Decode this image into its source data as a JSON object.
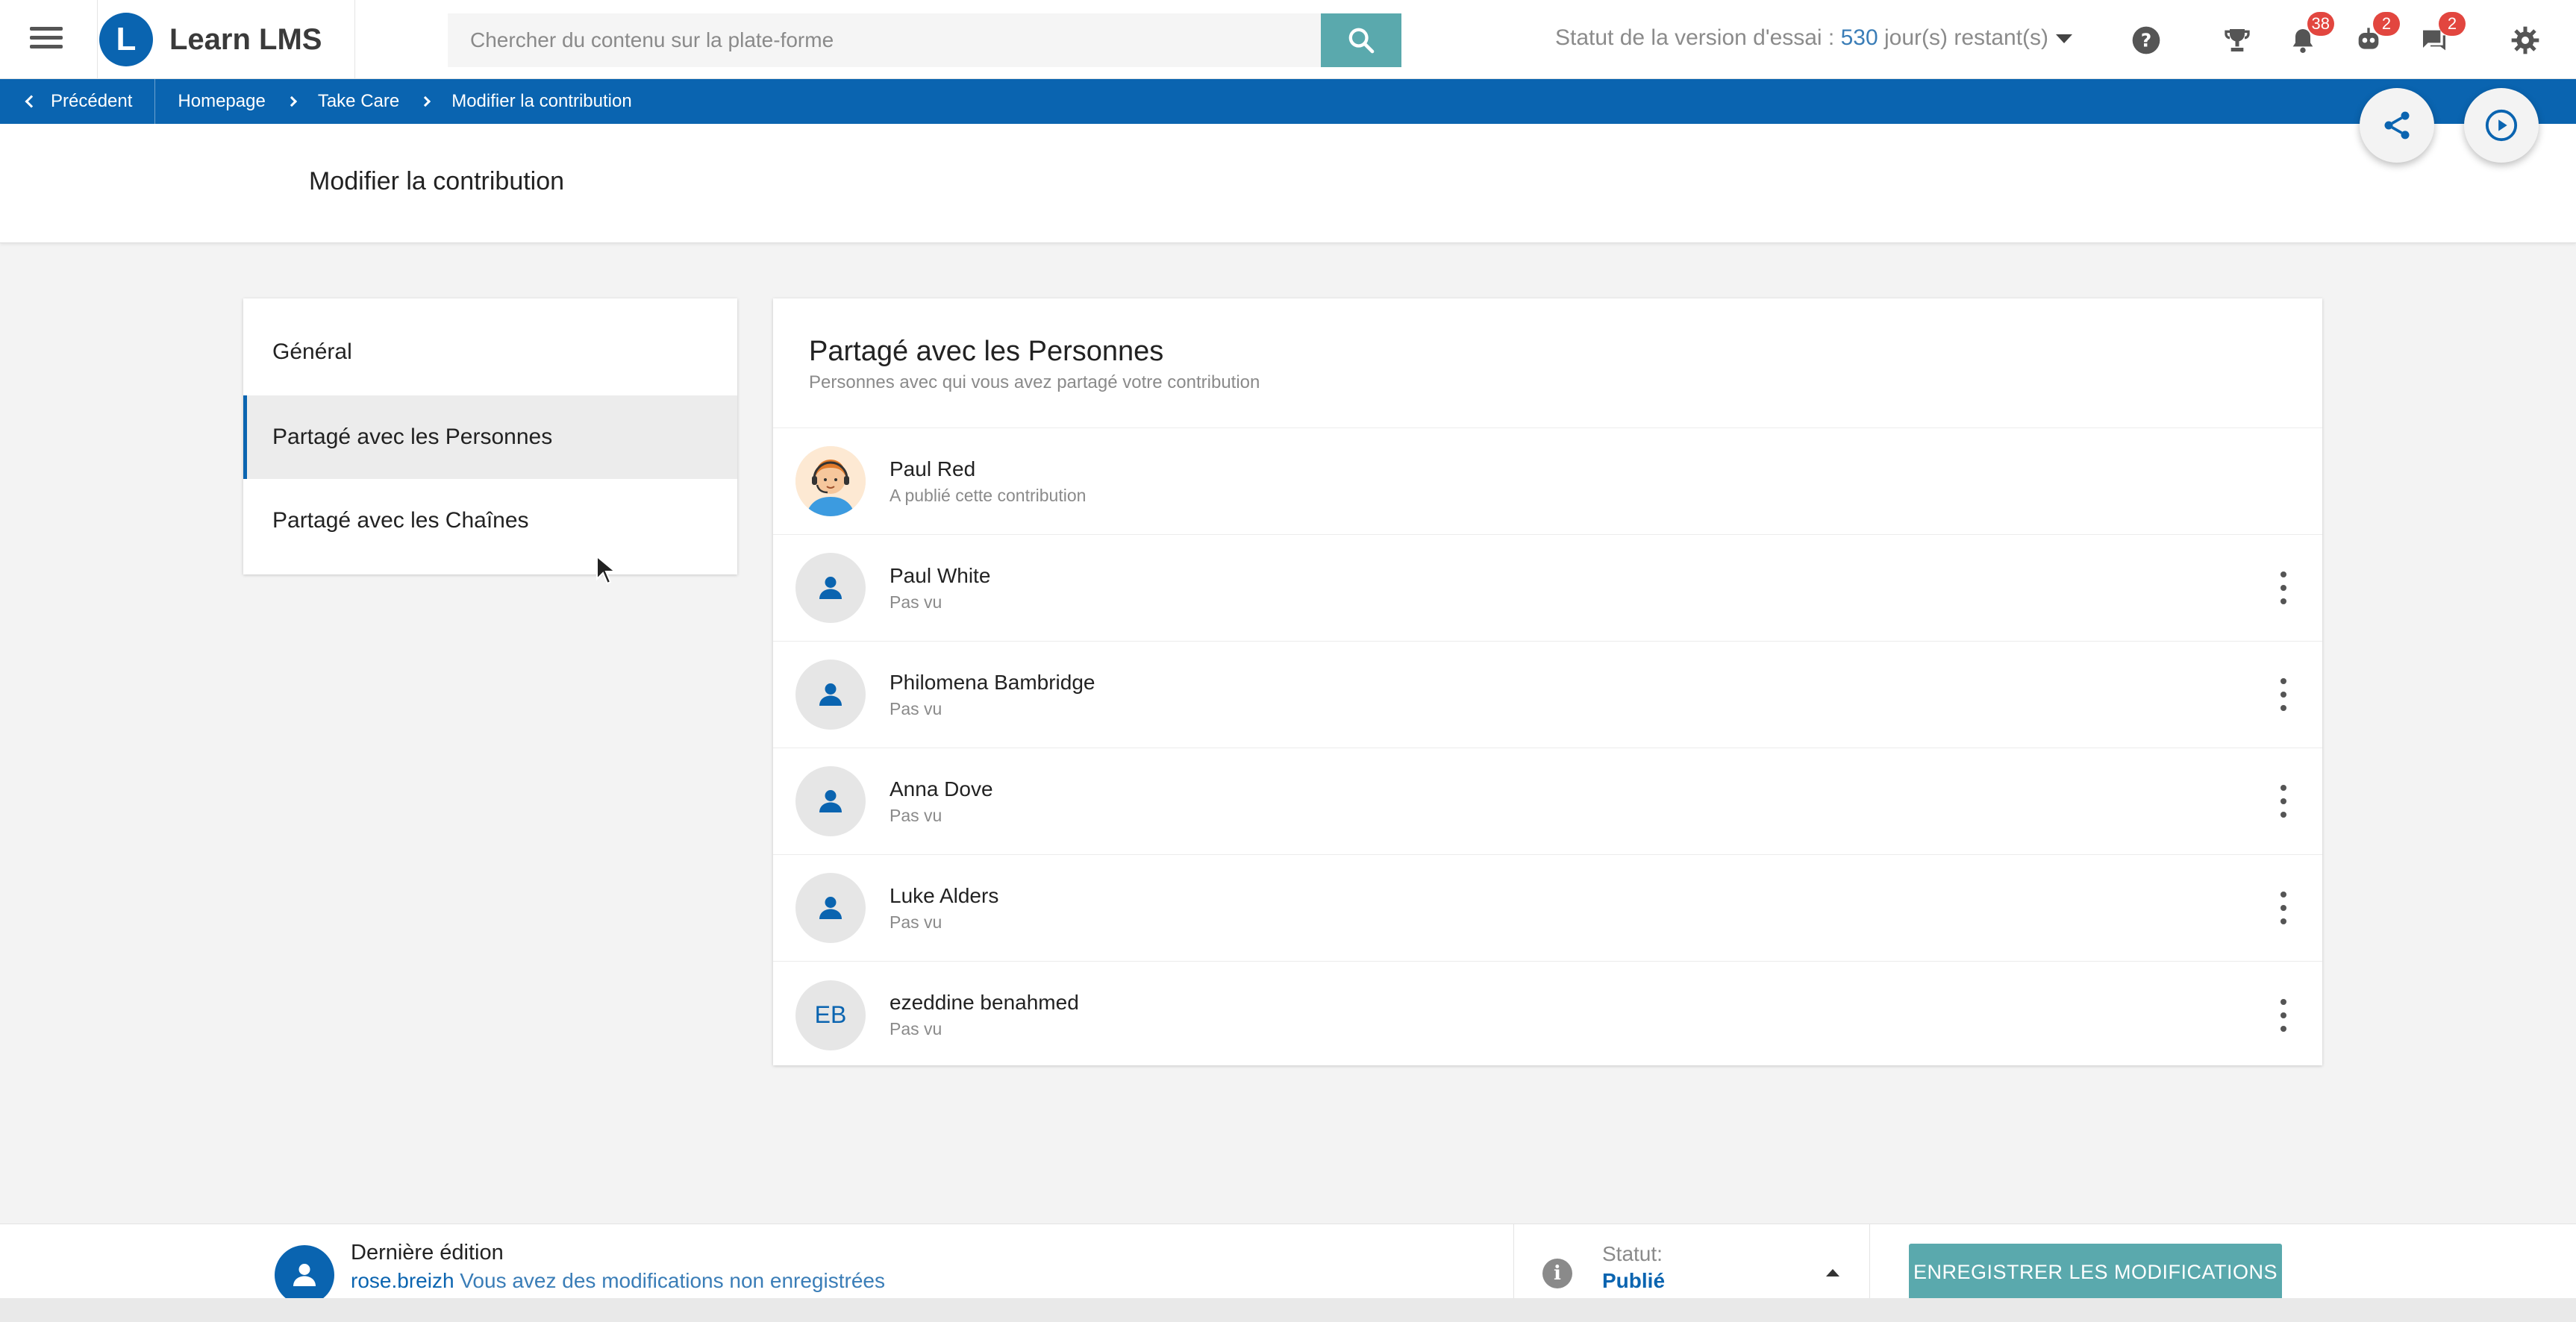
{
  "header": {
    "brand_name": "Learn LMS",
    "search_placeholder": "Chercher du contenu sur la plate-forme",
    "trial_label": "Statut de la version d'essai : ",
    "trial_days": "530",
    "trial_suffix": " jour(s) restant(s)",
    "notifications_count": "38",
    "badge_count": "2",
    "messages_count": "2"
  },
  "breadcrumb": {
    "back_label": "Précédent",
    "items": [
      "Homepage",
      "Take Care",
      "Modifier la contribution"
    ]
  },
  "page": {
    "title": "Modifier la contribution"
  },
  "sidemenu": {
    "items": [
      "Général",
      "Partagé avec les Personnes",
      "Partagé avec les Chaînes"
    ]
  },
  "panel": {
    "title": "Partagé avec les Personnes",
    "subtitle": "Personnes avec qui vous avez partagé votre contribution",
    "people": [
      {
        "name": "Paul Red",
        "status": "A publié cette contribution"
      },
      {
        "name": "Paul White",
        "status": "Pas vu"
      },
      {
        "name": "Philomena Bambridge",
        "status": "Pas vu"
      },
      {
        "name": "Anna Dove",
        "status": "Pas vu"
      },
      {
        "name": "Luke Alders",
        "status": "Pas vu"
      },
      {
        "name": "ezeddine benahmed",
        "status": "Pas vu",
        "initials": "EB"
      }
    ]
  },
  "footer": {
    "last_edit_title": "Dernière édition",
    "username": "rose.breizh",
    "unsaved_message": " Vous avez des modifications non enregistrées",
    "status_label": "Statut:",
    "status_value": "Publié",
    "save_label": "ENREGISTRER LES MODIFICATIONS"
  },
  "colors": {
    "primary": "#0a64b0",
    "accent": "#5aa9ad",
    "badge": "#e2463f"
  }
}
